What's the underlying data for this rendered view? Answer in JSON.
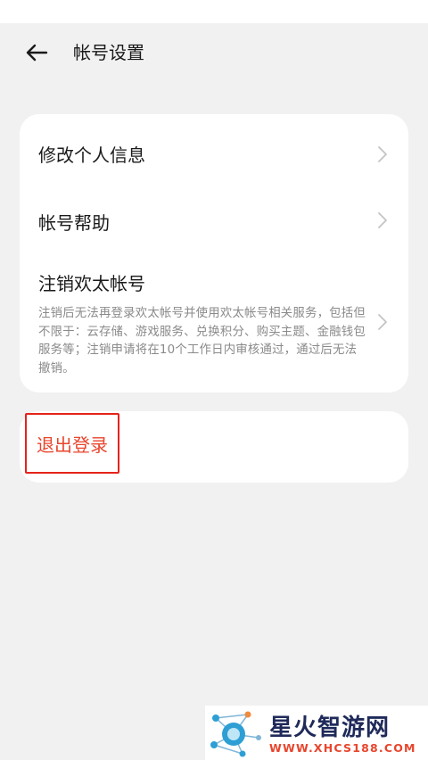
{
  "header": {
    "title": "帐号设置"
  },
  "icons": {
    "back": "back-arrow-icon",
    "chevron": "chevron-right-icon",
    "watermark_logo": "network-logo-icon"
  },
  "colors": {
    "background": "#f1f1f1",
    "card": "#ffffff",
    "text_primary": "#1a1a1a",
    "text_secondary": "#8a8a8a",
    "danger": "#e8452c",
    "highlight_border": "#e5231b"
  },
  "settings": {
    "items": [
      {
        "label": "修改个人信息"
      },
      {
        "label": "帐号帮助"
      },
      {
        "label": "注销欢太帐号",
        "description": "注销后无法再登录欢太帐号并使用欢太帐号相关服务，包括但不限于：云存储、游戏服务、兑换积分、购买主题、金融钱包服务等；注销申请将在10个工作日内审核通过，通过后无法撤销。"
      }
    ]
  },
  "logout": {
    "label": "退出登录"
  },
  "watermark": {
    "title": "星火智游网",
    "url": "WWW.XHCS188.COM"
  }
}
